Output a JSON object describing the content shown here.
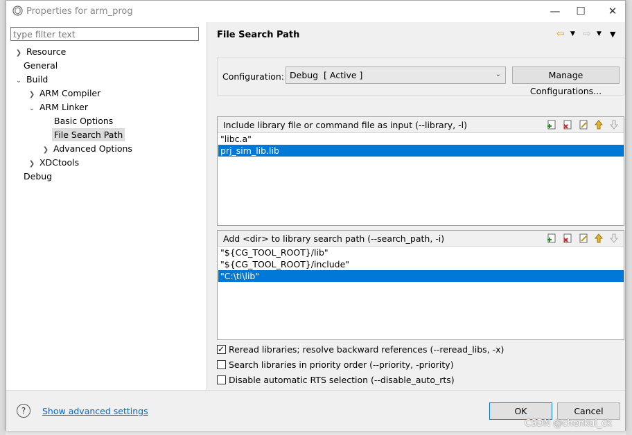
{
  "window": {
    "title": "Properties for arm_prog"
  },
  "filter": {
    "placeholder": "type filter text"
  },
  "tree": {
    "resource": "Resource",
    "general": "General",
    "build": "Build",
    "arm_compiler": "ARM Compiler",
    "arm_linker": "ARM Linker",
    "basic_options": "Basic Options",
    "file_search_path": "File Search Path",
    "advanced_options": "Advanced Options",
    "xdctools": "XDCtools",
    "debug": "Debug"
  },
  "page": {
    "title": "File Search Path"
  },
  "configuration": {
    "label": "Configuration:",
    "value": "Debug  [ Active ]",
    "manage_button": "Manage Configurations..."
  },
  "library_list": {
    "caption": "Include library file or command file as input (--library, -l)",
    "items": [
      "\"libc.a\"",
      "prj_sim_lib.lib"
    ]
  },
  "search_path_list": {
    "caption": "Add <dir> to library search path (--search_path, -i)",
    "items": [
      "\"${CG_TOOL_ROOT}/lib\"",
      "\"${CG_TOOL_ROOT}/include\"",
      "\"C:\\ti\\lib\""
    ]
  },
  "options": {
    "reread": {
      "label": "Reread libraries; resolve backward references (--reread_libs, -x)",
      "checked": true
    },
    "priority": {
      "label": "Search libraries in priority order (--priority, -priority)",
      "checked": false
    },
    "disable_rts": {
      "label": "Disable automatic RTS selection (--disable_auto_rts)",
      "checked": false
    }
  },
  "footer": {
    "advanced_link": "Show advanced settings",
    "ok": "OK",
    "cancel": "Cancel"
  },
  "watermark": "CSDN @chenkui_ck",
  "colors": {
    "selection": "#0078d7",
    "link": "#0066cc"
  }
}
